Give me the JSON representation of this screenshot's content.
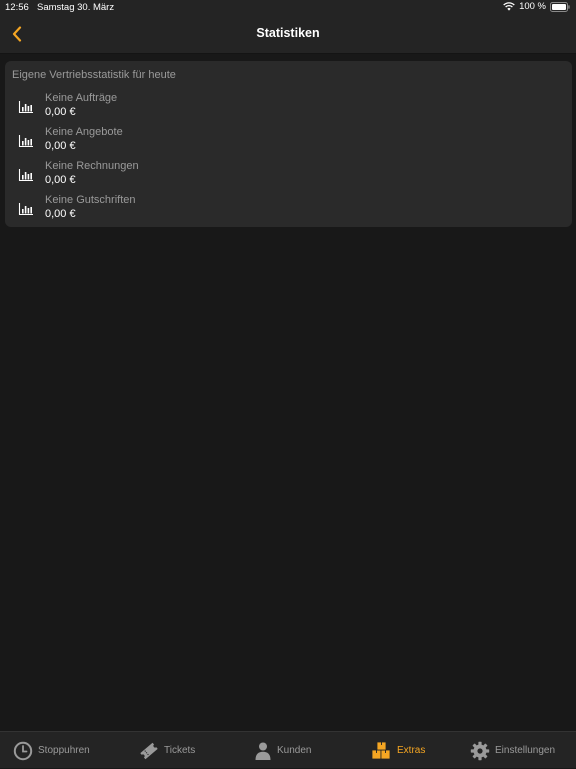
{
  "status_bar": {
    "time": "12:56",
    "date": "Samstag 30. März",
    "battery": "100 %"
  },
  "nav": {
    "title": "Statistiken"
  },
  "card": {
    "title": "Eigene Vertriebsstatistik für heute",
    "rows": [
      {
        "label": "Keine Aufträge",
        "value": "0,00 €",
        "icon": "bar-chart-icon"
      },
      {
        "label": "Keine Angebote",
        "value": "0,00 €",
        "icon": "bar-chart-icon"
      },
      {
        "label": "Keine Rechnungen",
        "value": "0,00 €",
        "icon": "bar-chart-icon"
      },
      {
        "label": "Keine Gutschriften",
        "value": "0,00 €",
        "icon": "bar-chart-icon"
      }
    ]
  },
  "tabs": [
    {
      "label": "Stoppuhren",
      "icon": "clock-icon",
      "active": false
    },
    {
      "label": "Tickets",
      "icon": "ticket-icon",
      "active": false
    },
    {
      "label": "Kunden",
      "icon": "person-icon",
      "active": false
    },
    {
      "label": "Extras",
      "icon": "boxes-icon",
      "active": true
    },
    {
      "label": "Einstellungen",
      "icon": "gear-icon",
      "active": false
    }
  ],
  "colors": {
    "accent": "#f5a623",
    "background": "#181818",
    "bar": "#242424",
    "card": "#2a2a2a",
    "muted_text": "#9a9a9a"
  }
}
